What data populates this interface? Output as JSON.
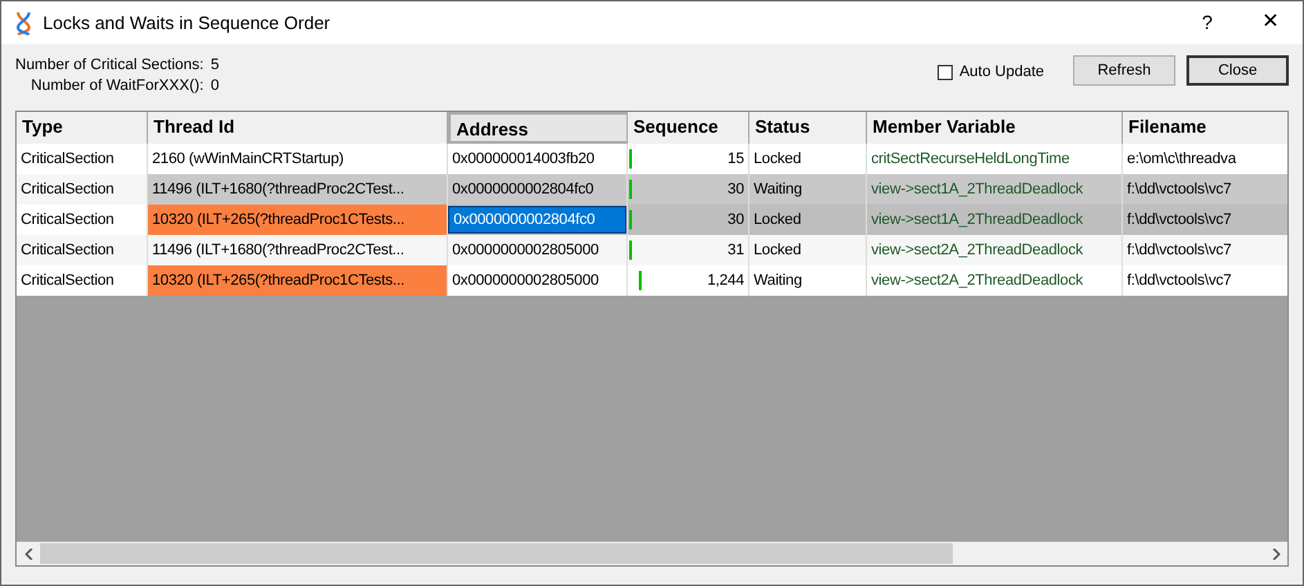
{
  "window": {
    "title": "Locks and Waits in Sequence Order",
    "help": "?",
    "close": "✕"
  },
  "summary": [
    {
      "label": "Number of Critical Sections:",
      "value": "5"
    },
    {
      "label": "Number of WaitForXXX():",
      "value": "0"
    }
  ],
  "auto_update": {
    "label": "Auto Update",
    "checked": false
  },
  "buttons": [
    "Refresh",
    "Close"
  ],
  "table": {
    "columns": [
      "Type",
      "Thread Id",
      "Address",
      "Sequence",
      "Status",
      "Member Variable",
      "Filename"
    ],
    "rows": [
      {
        "highlighted": false,
        "selected": false,
        "thread_flagged": false,
        "cells": [
          "CriticalSection",
          "2160 (wWinMainCRTStartup)",
          "0x000000014003fb20",
          "15",
          "Locked",
          "critSectRecurseHeldLongTime",
          "e:\\om\\c\\threadva"
        ]
      },
      {
        "highlighted": true,
        "selected": false,
        "thread_flagged": false,
        "cells": [
          "CriticalSection",
          "11496 (ILT+1680(?threadProc2CTest...",
          "0x0000000002804fc0",
          "30",
          "Waiting",
          "view->sect1A_2ThreadDeadlock",
          "f:\\dd\\vctools\\vc7"
        ]
      },
      {
        "highlighted": false,
        "selected": true,
        "thread_flagged": true,
        "cells": [
          "CriticalSection",
          "10320 (ILT+265(?threadProc1CTests...",
          "0x0000000002804fc0",
          "30",
          "Locked",
          "view->sect1A_2ThreadDeadlock",
          "f:\\dd\\vctools\\vc7"
        ]
      },
      {
        "highlighted": false,
        "selected": false,
        "thread_flagged": false,
        "cells": [
          "CriticalSection",
          "11496 (ILT+1680(?threadProc2CTest...",
          "0x0000000002805000",
          "31",
          "Locked",
          "view->sect2A_2ThreadDeadlock",
          "f:\\dd\\vctools\\vc7"
        ]
      },
      {
        "highlighted": false,
        "selected": false,
        "thread_flagged": true,
        "cells": [
          "CriticalSection",
          "10320 (ILT+265(?threadProc1CTests...",
          "0x0000000002805000",
          "1,244",
          "Waiting",
          "view->sect2A_2ThreadDeadlock",
          "f:\\dd\\vctools\\vc7"
        ]
      }
    ]
  }
}
